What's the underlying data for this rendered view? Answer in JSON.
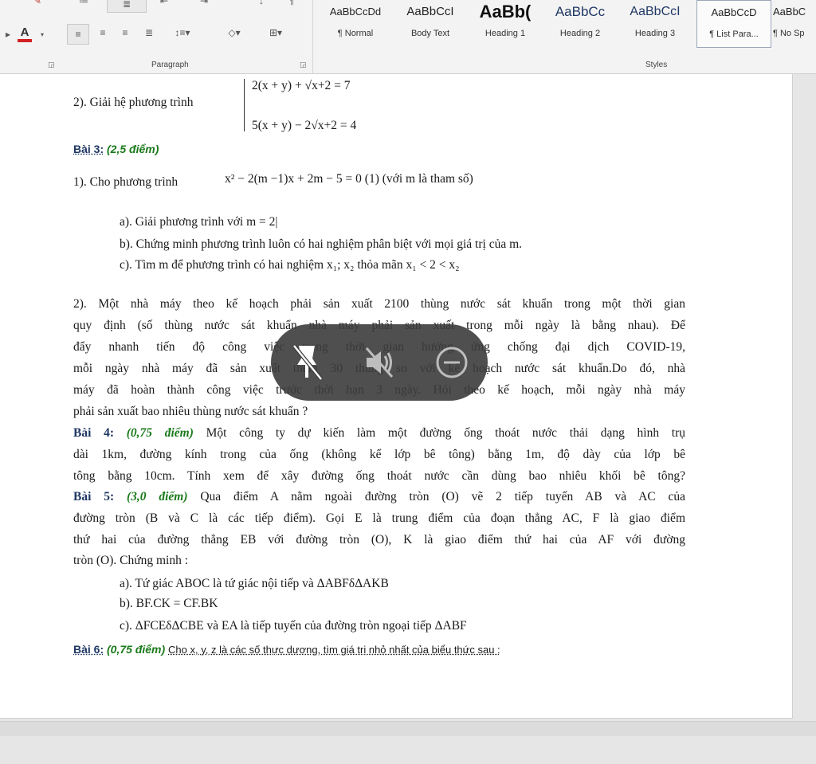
{
  "ribbon": {
    "paragraph_label": "Paragraph",
    "styles_label": "Styles",
    "styles": [
      {
        "preview": "AaBbCcDd",
        "name": "¶ Normal"
      },
      {
        "preview": "AaBbCcI",
        "name": "Body Text"
      },
      {
        "preview": "AaBb(",
        "name": "Heading 1"
      },
      {
        "preview": "AaBbCc",
        "name": "Heading 2"
      },
      {
        "preview": "AaBbCcI",
        "name": "Heading 3"
      },
      {
        "preview": "AaBbCcD",
        "name": "¶ List Para..."
      },
      {
        "preview": "AaBbC",
        "name": "¶ No Sp"
      }
    ]
  },
  "document": {
    "p2_label": "2). Giải hệ phương trình",
    "eq1": "2(x + y) + √x+2 = 7",
    "eq2": "5(x + y) − 2√x+2 = 4",
    "bai3_title": "Bài 3:",
    "bai3_points": "(2,5 điểm)",
    "b3_q1": "1). Cho phương trình",
    "b3_q1_eq": "x² − 2(m −1)x + 2m − 5 = 0 (1) (với m là tham số)",
    "b3_a": "a). Giải phương trình với  m = 2|",
    "b3_b": "b). Chứng minh phương trình luôn có hai nghiệm phân biệt với mọi giá trị của m.",
    "b3_c": "c). Tìm m để phương trình có hai nghiệm  x₁; x₂  thỏa mãn  x₁ < 2 < x₂",
    "b3_q2_lines": [
      "2). Một nhà máy theo kế hoạch phải sản xuất 2100 thùng nước sát khuẩn trong một thời gian",
      "quy định (số thùng nước sát khuẩn nhà máy phải sản xuất trong mỗi ngày là bằng nhau). Để",
      "đẩy nhanh tiến độ công việc trong thời gian hưởng ứng chống đại dịch COVID-19,",
      "mỗi ngày nhà máy đã sản xuất thêm 30 thùng so với kế hoạch nước sát khuẩn.Do đó, nhà",
      "máy đã hoàn thành công việc trước thời hạn 3 ngày. Hỏi theo kế hoạch, mỗi ngày nhà máy"
    ],
    "b3_q2_last": "phải sản xuất bao nhiêu thùng nước sát khuẩn ?",
    "bai4_title": "Bài 4:",
    "bai4_points": "(0,75 điểm)",
    "bai4_line1": "Một công ty dự kiến làm một đường ống thoát nước thải dạng hình trụ",
    "bai4_line2": "dài 1km, đường kính trong của ống (không kể lớp bê tông) bằng 1m, độ dày của lớp bê",
    "bai4_line3": "tông bằng 10cm. Tính  xem để xây đường ống thoát nước cần dùng bao nhiêu khối  bê tông?",
    "bai5_title": "Bài 5:",
    "bai5_points": "(3,0 điểm)",
    "bai5_line1": "Qua điểm A nằm ngoài đường tròn (O) vẽ 2 tiếp tuyến AB và AC của",
    "bai5_line2": "đường tròn (B và C là các tiếp điểm). Gọi E là trung điểm của đoạn thẳng AC, F là giao điểm",
    "bai5_line3": "thứ hai của đường thẳng EB với đường tròn (O), K là giao điểm thứ hai của AF với đường",
    "bai5_line4": "tròn (O). Chứng minh :",
    "b5_a": "a). Tứ giác ABOC là tứ giác nội tiếp và ΔABFδΔAKB",
    "b5_b": "b). BF.CK = CF.BK",
    "b5_c": "c). ΔFCEδΔCBE  và EA là tiếp tuyến của đường tròn ngoại tiếp ΔABF",
    "bai6_title": "Bài 6:",
    "bai6_points": "(0,75 điểm)",
    "bai6_text": "Cho x, y, z  là các số thực dương, tìm giá trị nhỏ nhất của biểu thức sau :"
  },
  "overlay": {
    "icons": [
      "pin-off-icon",
      "mute-icon",
      "minimize-icon"
    ]
  }
}
